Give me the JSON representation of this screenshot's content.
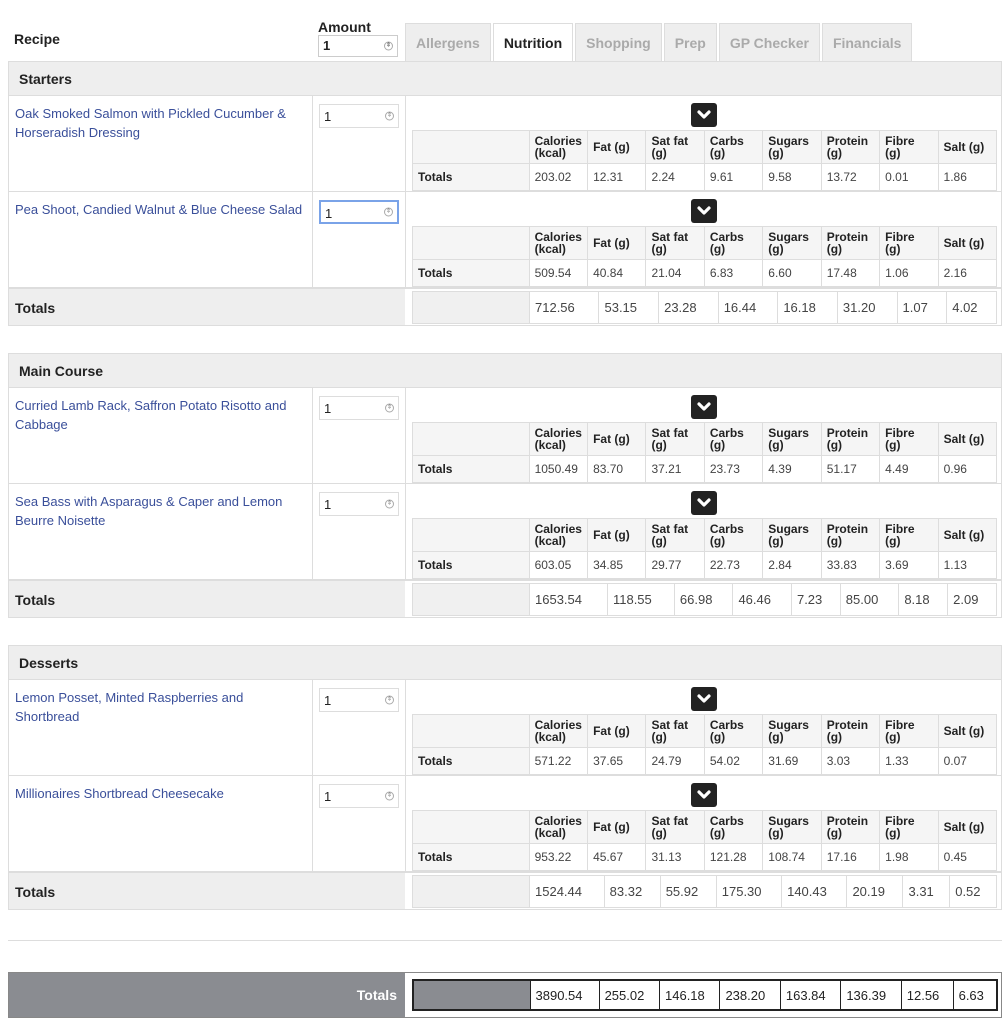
{
  "header": {
    "recipe_label": "Recipe",
    "amount_label": "Amount",
    "amount_value": "1",
    "tabs": [
      {
        "label": "Allergens",
        "active": false
      },
      {
        "label": "Nutrition",
        "active": true
      },
      {
        "label": "Shopping",
        "active": false
      },
      {
        "label": "Prep",
        "active": false
      },
      {
        "label": "GP Checker",
        "active": false
      },
      {
        "label": "Financials",
        "active": false
      }
    ]
  },
  "columns": [
    "Calories (kcal)",
    "Fat (g)",
    "Sat fat (g)",
    "Carbs (g)",
    "Sugars (g)",
    "Protein (g)",
    "Fibre (g)",
    "Salt (g)"
  ],
  "row_totals_label": "Totals",
  "sections": [
    {
      "title": "Starters",
      "recipes": [
        {
          "name": "Oak Smoked Salmon with Pickled Cucumber & Horseradish Dressing",
          "amount": "1",
          "values": [
            "203.02",
            "12.31",
            "2.24",
            "9.61",
            "9.58",
            "13.72",
            "0.01",
            "1.86"
          ]
        },
        {
          "name": "Pea Shoot, Candied Walnut & Blue Cheese Salad",
          "amount": "1",
          "values": [
            "509.54",
            "40.84",
            "21.04",
            "6.83",
            "6.60",
            "17.48",
            "1.06",
            "2.16"
          ]
        }
      ],
      "totals_label": "Totals",
      "totals": [
        "712.56",
        "53.15",
        "23.28",
        "16.44",
        "16.18",
        "31.20",
        "1.07",
        "4.02"
      ]
    },
    {
      "title": "Main Course",
      "recipes": [
        {
          "name": "Curried Lamb Rack, Saffron Potato Risotto and Cabbage",
          "amount": "1",
          "values": [
            "1050.49",
            "83.70",
            "37.21",
            "23.73",
            "4.39",
            "51.17",
            "4.49",
            "0.96"
          ]
        },
        {
          "name": "Sea Bass with Asparagus & Caper and Lemon Beurre Noisette",
          "amount": "1",
          "values": [
            "603.05",
            "34.85",
            "29.77",
            "22.73",
            "2.84",
            "33.83",
            "3.69",
            "1.13"
          ]
        }
      ],
      "totals_label": "Totals",
      "totals": [
        "1653.54",
        "118.55",
        "66.98",
        "46.46",
        "7.23",
        "85.00",
        "8.18",
        "2.09"
      ]
    },
    {
      "title": "Desserts",
      "recipes": [
        {
          "name": "Lemon Posset, Minted Raspberries and Shortbread",
          "amount": "1",
          "values": [
            "571.22",
            "37.65",
            "24.79",
            "54.02",
            "31.69",
            "3.03",
            "1.33",
            "0.07"
          ]
        },
        {
          "name": "Millionaires Shortbread Cheesecake",
          "amount": "1",
          "values": [
            "953.22",
            "45.67",
            "31.13",
            "121.28",
            "108.74",
            "17.16",
            "1.98",
            "0.45"
          ]
        }
      ],
      "totals_label": "Totals",
      "totals": [
        "1524.44",
        "83.32",
        "55.92",
        "175.30",
        "140.43",
        "20.19",
        "3.31",
        "0.52"
      ]
    }
  ],
  "grand_total": {
    "label": "Totals",
    "values": [
      "3890.54",
      "255.02",
      "146.18",
      "238.20",
      "163.84",
      "136.39",
      "12.56",
      "6.63"
    ]
  }
}
